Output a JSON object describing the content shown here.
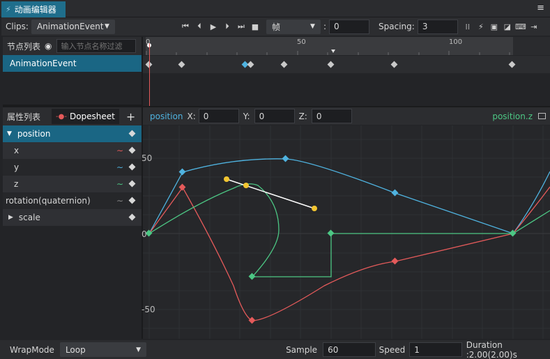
{
  "window": {
    "tab_title": "动画编辑器",
    "menu_glyph": "≡"
  },
  "toolbar": {
    "clips_label": "Clips:",
    "clip_selected": "AnimationEvent",
    "unit_selected": "帧",
    "colon": ":",
    "frame_value": "0",
    "spacing_label": "Spacing:",
    "spacing_value": "3"
  },
  "nodes": {
    "header_label": "节点列表",
    "search_placeholder": "输入节点名称过滤",
    "items": [
      "AnimationEvent"
    ]
  },
  "ruler": {
    "ticks": [
      "0",
      "50",
      "100"
    ]
  },
  "properties": {
    "header_label": "属性列表",
    "dopesheet_label": "Dopesheet",
    "add_glyph": "+",
    "rows": [
      {
        "label": "position",
        "selected": true,
        "expanded": true
      },
      {
        "label": "x",
        "curve_color": "#e45a5a"
      },
      {
        "label": "y",
        "curve_color": "#4fb3e0"
      },
      {
        "label": "z",
        "curve_color": "#4cc784"
      },
      {
        "label": "rotation(quaternion)",
        "curve_color": "#888888"
      },
      {
        "label": "scale",
        "expanded": false
      }
    ]
  },
  "curve_header": {
    "prop_name": "position",
    "x_label": "X:",
    "x_value": "0",
    "y_label": "Y:",
    "y_value": "0",
    "z_label": "Z:",
    "z_value": "0",
    "active_curve": "position.z"
  },
  "curve_axis": {
    "labels": [
      "50",
      "0",
      "-50"
    ]
  },
  "footer": {
    "wrapmode_label": "WrapMode",
    "wrapmode_value": "Loop",
    "sample_label": "Sample",
    "sample_value": "60",
    "speed_label": "Speed",
    "speed_value": "1",
    "duration_text": "Duration :2.00(2.00)s"
  },
  "colors": {
    "accent": "#1f6e8c",
    "x_curve": "#e45a5a",
    "y_curve": "#4fb3e0",
    "z_curve": "#4cc784",
    "handle": "#f2c531"
  }
}
